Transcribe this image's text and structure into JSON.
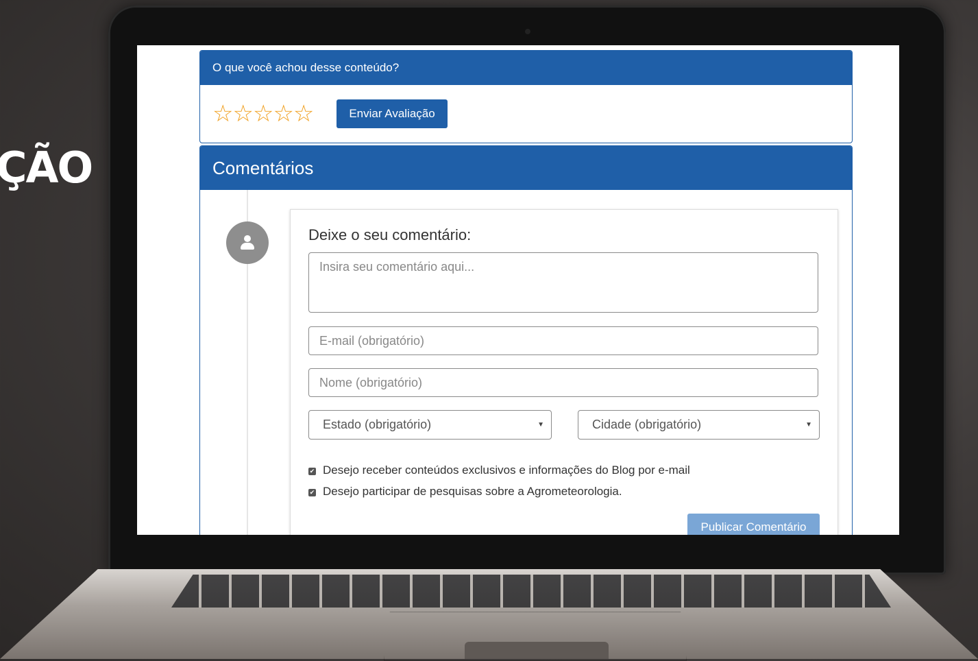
{
  "background": {
    "headline_fragment": "ÇÃO"
  },
  "rating": {
    "question": "O que você achou desse conteúdo?",
    "stars": "☆☆☆☆☆",
    "stars_value": 0,
    "stars_max": 5,
    "submit_label": "Enviar Avaliação"
  },
  "comments": {
    "title": "Comentários",
    "form_title": "Deixe o seu comentário:",
    "comment_placeholder": "Insira seu comentário aqui...",
    "email_placeholder": "E-mail (obrigatório)",
    "name_placeholder": "Nome (obrigatório)",
    "state_select": "Estado (obrigatório)",
    "city_select": "Cidade (obrigatório)",
    "caret": "▼",
    "checkbox_1": "Desejo receber conteúdos exclusivos e informações do Blog por e-mail",
    "checkbox_2": "Desejo participar de pesquisas sobre a Agrometeorologia.",
    "checkbox_1_checked": true,
    "checkbox_2_checked": true,
    "publish_label": "Publicar Comentário"
  },
  "colors": {
    "primary": "#1f5fa8",
    "star": "#f0a020",
    "publish_disabled": "#7aa6d6"
  }
}
